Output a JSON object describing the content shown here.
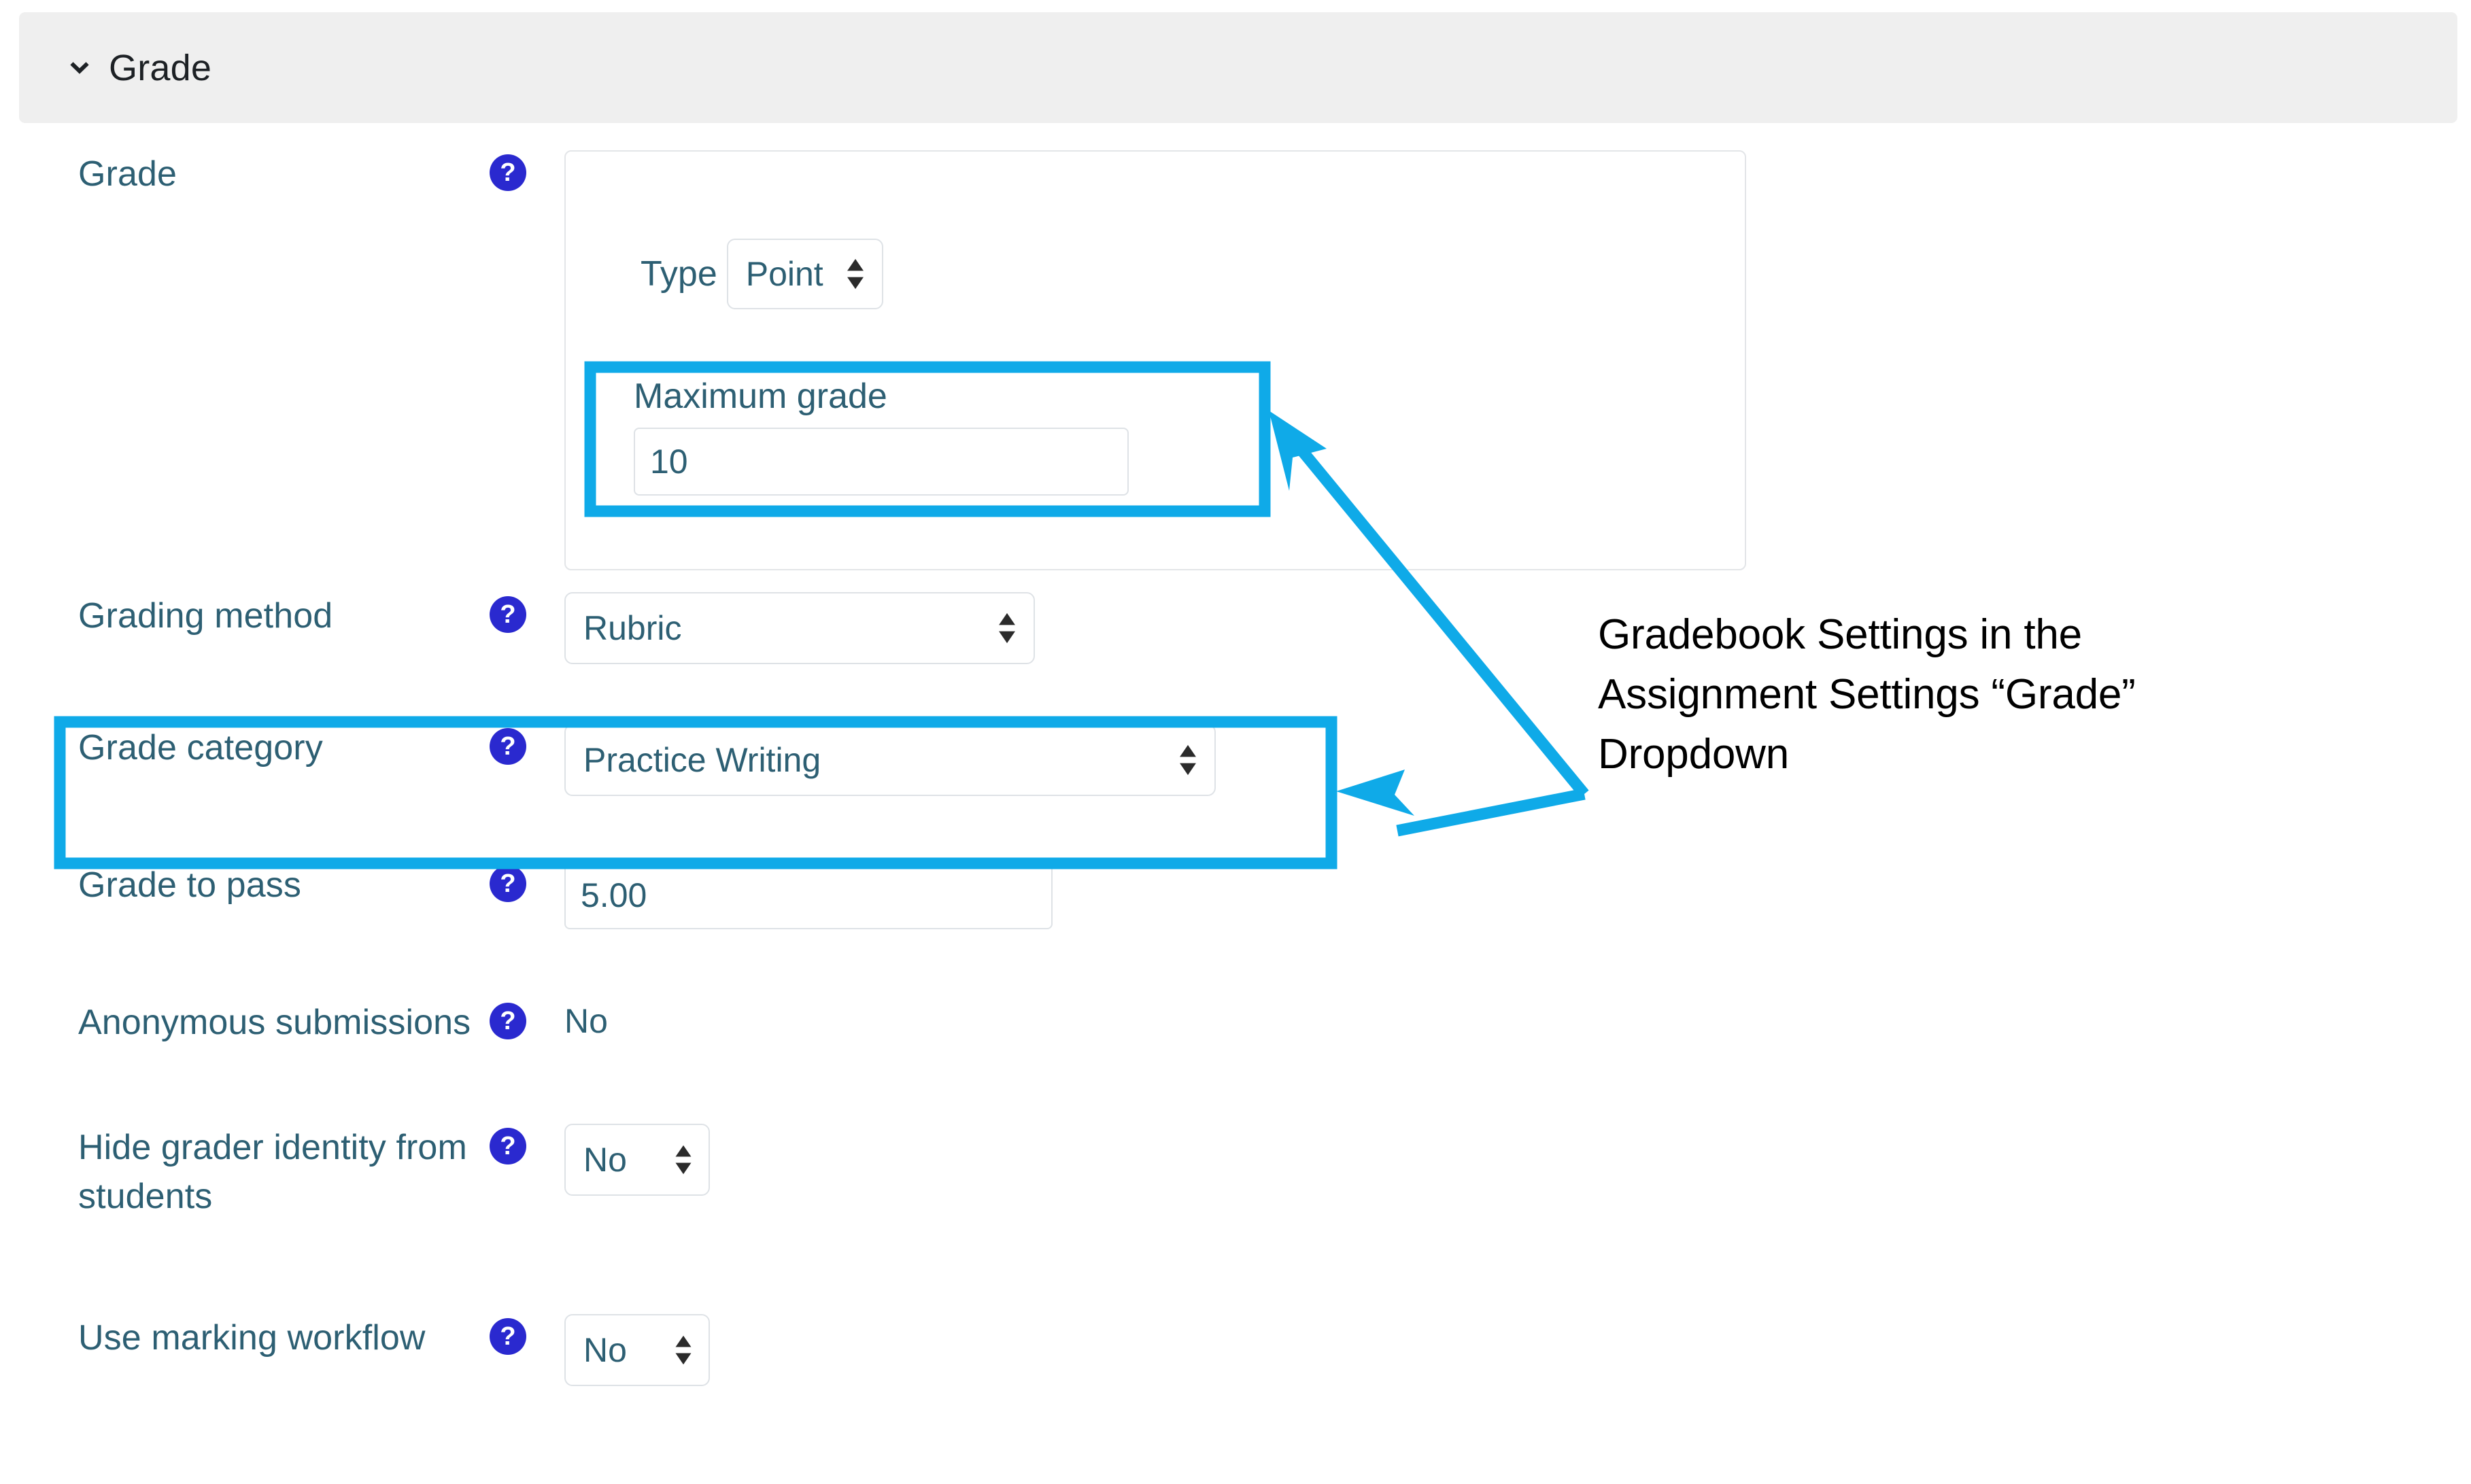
{
  "section": {
    "title": "Grade",
    "collapse_icon": "chevron-down-icon",
    "expanded": true
  },
  "colors": {
    "highlight": "#0FAAE8",
    "help_icon_bg": "#2A29CF",
    "label_text": "#2D5F73",
    "header_bg": "#EFEFEF",
    "field_border": "#DEE2E6"
  },
  "help_icon_glyph": "?",
  "grade_fieldset": {
    "type_label": "Type",
    "type_value": "Point",
    "maximum_grade_label": "Maximum grade",
    "maximum_grade_value": "10"
  },
  "rows": [
    {
      "label": "Grade",
      "help": "?",
      "control": "fieldset"
    },
    {
      "label": "Grading method",
      "help": "?",
      "control": "select",
      "value": "Rubric"
    },
    {
      "label": "Grade category",
      "help": "?",
      "control": "select",
      "value": "Practice Writing"
    },
    {
      "label": "Grade to pass",
      "help": "?",
      "control": "input",
      "value": "5.00"
    },
    {
      "label": "Anonymous submissions",
      "help": "?",
      "control": "readonly",
      "value": "No"
    },
    {
      "label": "Hide grader identity from students",
      "help": "?",
      "control": "select",
      "value": "No"
    },
    {
      "label": "Use marking workflow",
      "help": "?",
      "control": "select",
      "value": "No"
    }
  ],
  "annotation": {
    "text": "Gradebook Settings in the Assignment Settings “Grade” Dropdown",
    "line1": "Gradebook Settings in the",
    "line2": "Assignment Settings “Grade”",
    "line3": "Dropdown"
  }
}
